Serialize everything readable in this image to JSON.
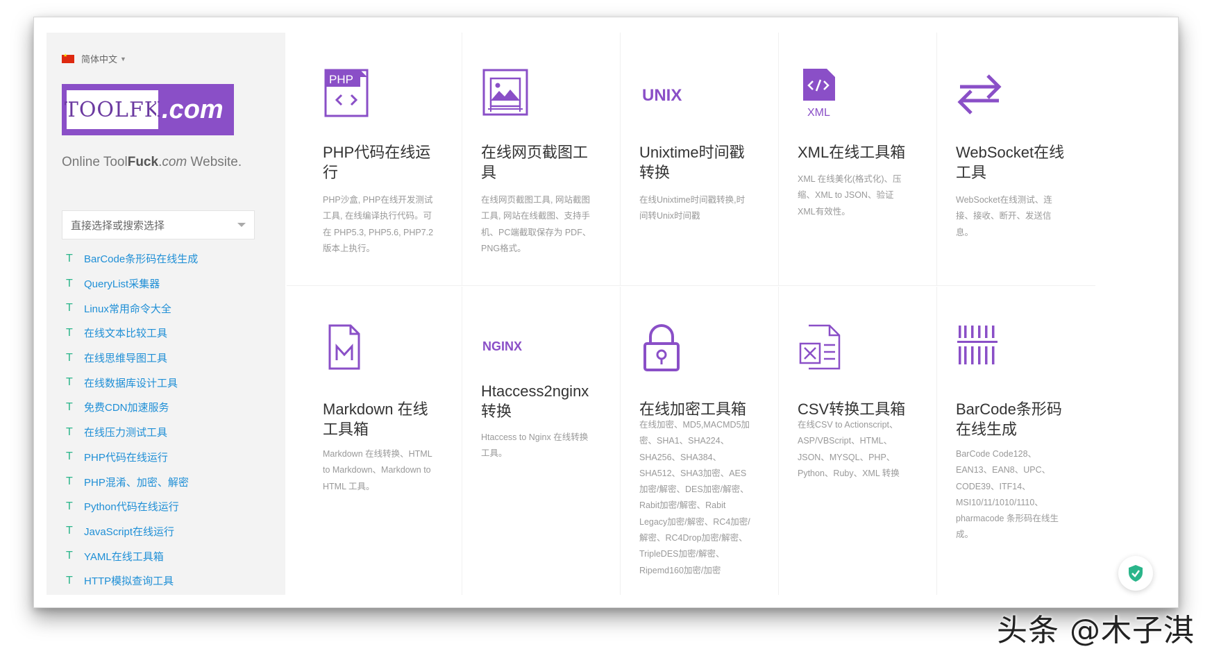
{
  "language": {
    "label": "简体中文"
  },
  "logo": {
    "part1": "TOOLFK",
    "part2": ".com"
  },
  "tagline": {
    "pre": "Online Tool",
    "bold": "Fuck",
    "dot": ".",
    "italic": "com",
    "post": " Website."
  },
  "search": {
    "placeholder": "直接选择或搜索选择"
  },
  "sidebar": {
    "items": [
      "BarCode条形码在线生成",
      "QueryList采集器",
      "Linux常用命令大全",
      "在线文本比较工具",
      "在线思维导图工具",
      "在线数据库设计工具",
      "免费CDN加速服务",
      "在线压力测试工具",
      "PHP代码在线运行",
      "PHP混淆、加密、解密",
      "Python代码在线运行",
      "JavaScript在线运行",
      "YAML在线工具箱",
      "HTTP模拟查询工具"
    ],
    "item_prefix": "T"
  },
  "cards": [
    {
      "icon": "php-code-icon",
      "icon_text": "PHP",
      "title": "PHP代码在线运行",
      "desc": "PHP沙盒, PHP在线开发测试工具, 在线编译执行代码。可在 PHP5.3, PHP5.6, PHP7.2 版本上执行。"
    },
    {
      "icon": "screenshot-image-icon",
      "title": "在线网页截图工具",
      "desc": "在线网页截图工具, 网站截图工具, 网站在线截图、支持手机、PC端截取保存为 PDF、PNG格式。"
    },
    {
      "icon": "unix-icon",
      "icon_text": "UNIX",
      "title": "Unixtime时间戳转换",
      "desc": "在线Unixtime时间戳转换,时间转Unix时间戳"
    },
    {
      "icon": "xml-file-icon",
      "icon_text": "XML",
      "title": "XML在线工具箱",
      "desc": "XML 在线美化(格式化)、压缩、XML to JSON、验证XML有效性。"
    },
    {
      "icon": "swap-arrows-icon",
      "title": "WebSocket在线工具",
      "desc": "WebSocket在线测试、连接、接收、断开、发送信息。"
    },
    {
      "icon": "markdown-file-icon",
      "title": "Markdown 在线工具箱",
      "desc": "Markdown 在线转换、HTML to Markdown、Markdown to HTML 工具。"
    },
    {
      "icon": "nginx-icon",
      "icon_text": "NGINX",
      "title": "Htaccess2nginx 转换",
      "desc": "Htaccess to Nginx 在线转换工具。"
    },
    {
      "icon": "lock-icon",
      "title": "在线加密工具箱",
      "desc": "在线加密、MD5,MACMD5加密、SHA1、SHA224、SHA256、SHA384、SHA512、SHA3加密、AES加密/解密、DES加密/解密、Rabit加密/解密、Rabit Legacy加密/解密、RC4加密/解密、RC4Drop加密/解密、TripleDES加密/解密、Ripemd160加密/加密"
    },
    {
      "icon": "csv-excel-icon",
      "title": "CSV转换工具箱",
      "desc": "在线CSV to Actionscript、ASP/VBScript、HTML、JSON、MYSQL、PHP、Python、Ruby、XML 转换"
    },
    {
      "icon": "barcode-icon",
      "title": "BarCode条形码在线生成",
      "desc": "BarCode Code128、EAN13、EAN8、UPC、CODE39、ITF14、MSI10/11/1010/1110、pharmacode 条形码在线生成。"
    }
  ],
  "watermark": "头条 @木子淇",
  "colors": {
    "accent": "#8a4fc7",
    "link": "#1f8fd6",
    "bullet": "#2ab58a",
    "shield": "#2ab58a"
  }
}
